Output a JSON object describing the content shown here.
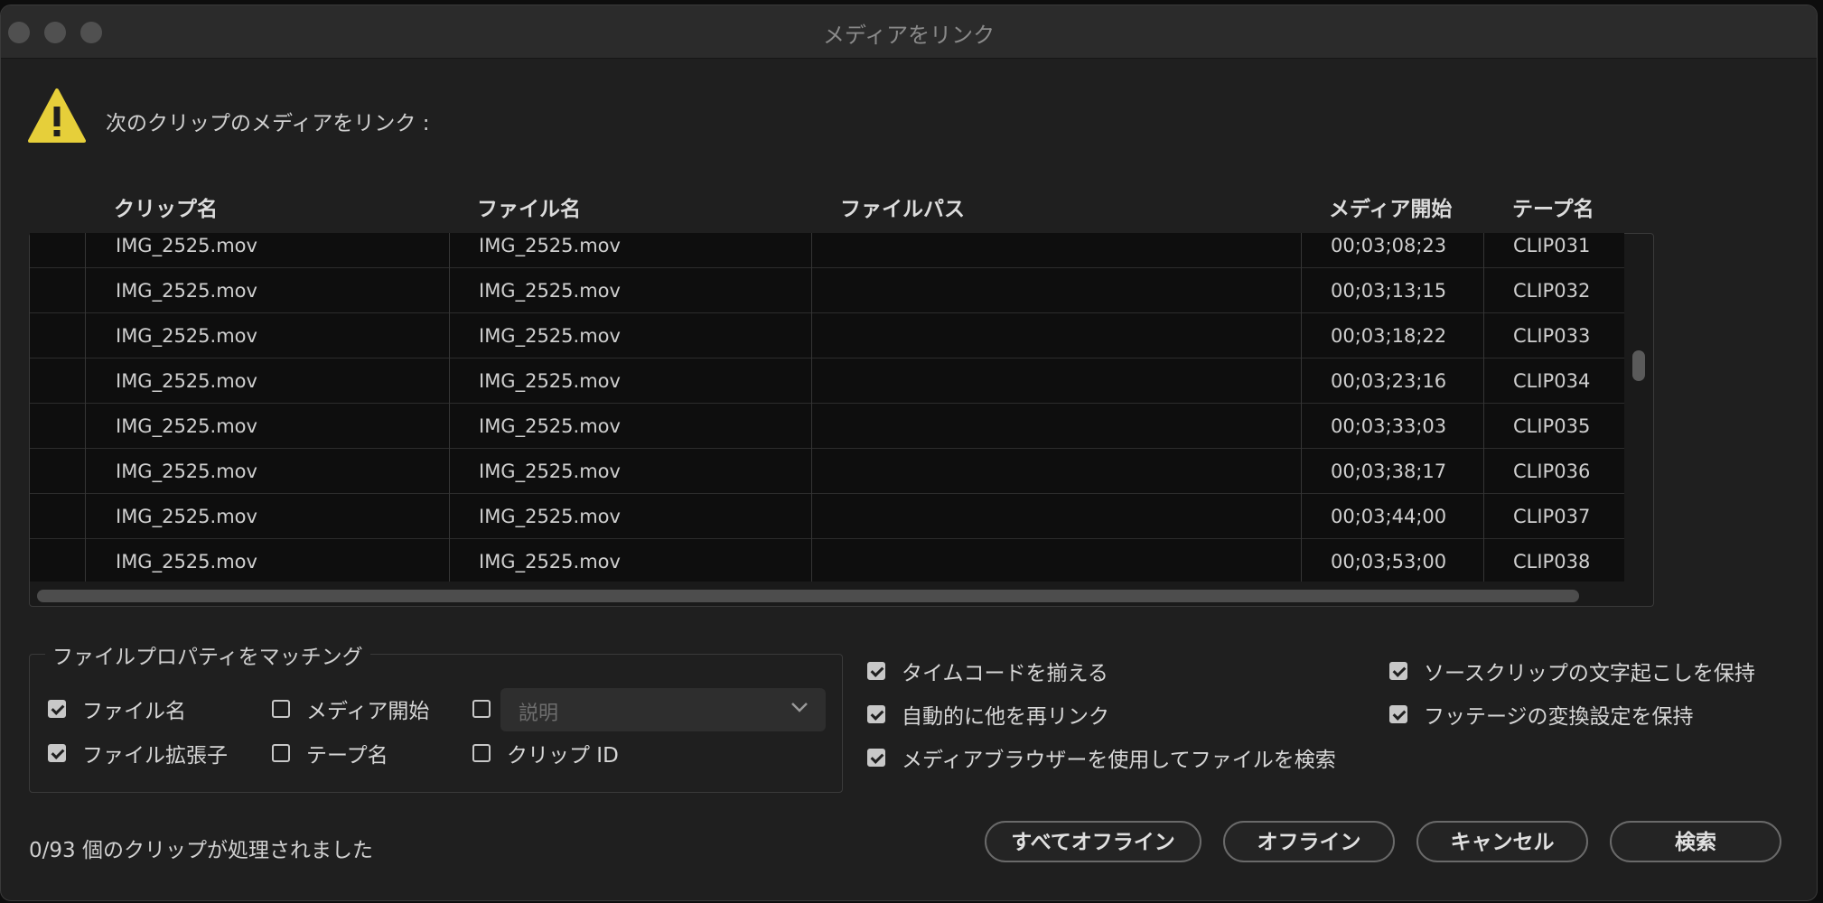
{
  "window": {
    "title": "メディアをリンク"
  },
  "header": {
    "text": "次のクリップのメディアをリンク :",
    "icon": "warning-icon",
    "icon_color": "#e6cf3a"
  },
  "table": {
    "columns": [
      "クリップ名",
      "ファイル名",
      "ファイルパス",
      "メディア開始",
      "テープ名"
    ],
    "rows": [
      {
        "clip": "IMG_2525.mov",
        "file": "IMG_2525.mov",
        "path": "",
        "start": "00;03;08;23",
        "tape": "CLIP031"
      },
      {
        "clip": "IMG_2525.mov",
        "file": "IMG_2525.mov",
        "path": "",
        "start": "00;03;13;15",
        "tape": "CLIP032"
      },
      {
        "clip": "IMG_2525.mov",
        "file": "IMG_2525.mov",
        "path": "",
        "start": "00;03;18;22",
        "tape": "CLIP033"
      },
      {
        "clip": "IMG_2525.mov",
        "file": "IMG_2525.mov",
        "path": "",
        "start": "00;03;23;16",
        "tape": "CLIP034"
      },
      {
        "clip": "IMG_2525.mov",
        "file": "IMG_2525.mov",
        "path": "",
        "start": "00;03;33;03",
        "tape": "CLIP035"
      },
      {
        "clip": "IMG_2525.mov",
        "file": "IMG_2525.mov",
        "path": "",
        "start": "00;03;38;17",
        "tape": "CLIP036"
      },
      {
        "clip": "IMG_2525.mov",
        "file": "IMG_2525.mov",
        "path": "",
        "start": "00;03;44;00",
        "tape": "CLIP037"
      },
      {
        "clip": "IMG_2525.mov",
        "file": "IMG_2525.mov",
        "path": "",
        "start": "00;03;53;00",
        "tape": "CLIP038"
      }
    ]
  },
  "match": {
    "legend": "ファイルプロパティをマッチング",
    "file_name": {
      "label": "ファイル名",
      "checked": true
    },
    "file_ext": {
      "label": "ファイル拡張子",
      "checked": true
    },
    "media_start": {
      "label": "メディア開始",
      "checked": false
    },
    "tape_name": {
      "label": "テープ名",
      "checked": false
    },
    "description": {
      "checked": false,
      "placeholder": "説明"
    },
    "clip_id": {
      "label": "クリップ ID",
      "checked": false
    }
  },
  "options": {
    "align_timecode": {
      "label": "タイムコードを揃える",
      "checked": true
    },
    "auto_relink": {
      "label": "自動的に他を再リンク",
      "checked": true
    },
    "use_media_browser": {
      "label": "メディアブラウザーを使用してファイルを検索",
      "checked": true
    },
    "keep_transcript": {
      "label": "ソースクリップの文字起こしを保持",
      "checked": true
    },
    "keep_interpret": {
      "label": "フッテージの変換設定を保持",
      "checked": true
    }
  },
  "status": "0/93 個のクリップが処理されました",
  "buttons": {
    "offline_all": "すべてオフライン",
    "offline": "オフライン",
    "cancel": "キャンセル",
    "search": "検索"
  }
}
